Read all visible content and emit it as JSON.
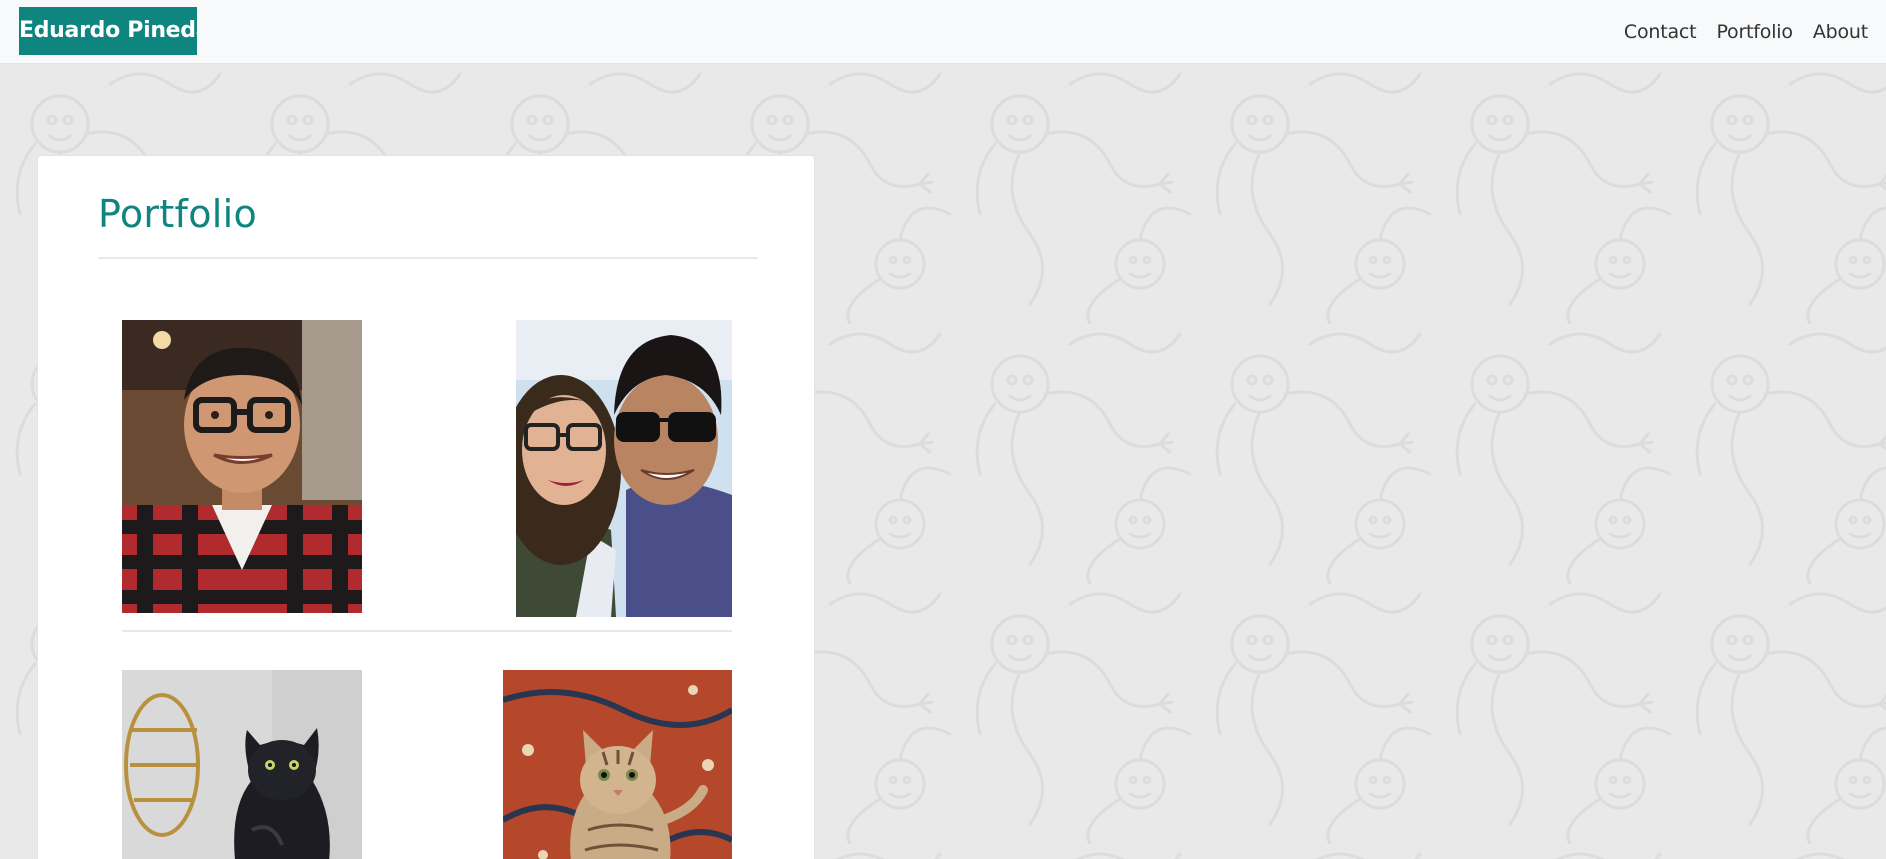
{
  "navbar": {
    "brand": "Eduardo Pineda",
    "links": [
      "Contact",
      "Portfolio",
      "About"
    ]
  },
  "main": {
    "title": "Portfolio"
  },
  "photos": [
    {
      "subject": "man-in-glasses-plaid-shirt"
    },
    {
      "subject": "couple-selfie"
    },
    {
      "subject": "black-cat"
    },
    {
      "subject": "tabby-cat-on-rug"
    }
  ],
  "colors": {
    "accent": "#0f8580",
    "navbar_bg": "#f8f9fa",
    "page_bg": "#e9e9e9",
    "card_bg": "#ffffff",
    "nav_text": "#333333"
  }
}
